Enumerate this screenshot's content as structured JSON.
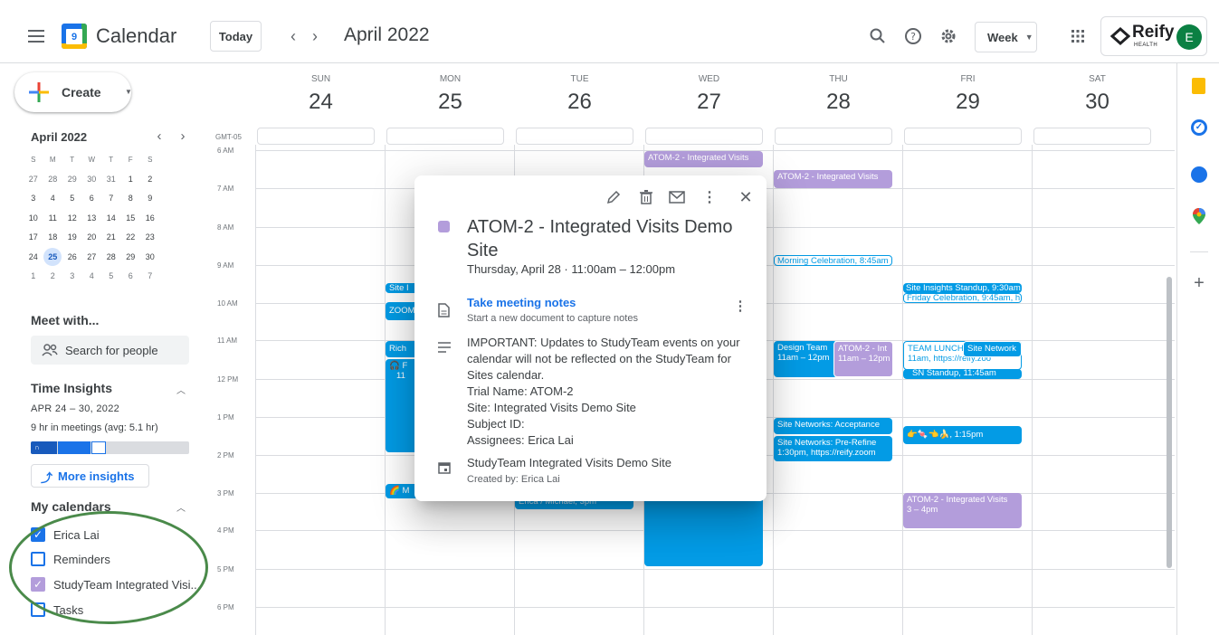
{
  "header": {
    "app_title": "Calendar",
    "logo_day": "9",
    "today_label": "Today",
    "period_label": "April 2022",
    "view_label": "Week",
    "brand_text": "Reify",
    "brand_sub": "HEALTH",
    "avatar_letter": "E"
  },
  "sidebar": {
    "create_label": "Create",
    "mini_cal": {
      "title": "April 2022",
      "weekdays": [
        "S",
        "M",
        "T",
        "W",
        "T",
        "F",
        "S"
      ],
      "weeks": [
        [
          "27",
          "28",
          "29",
          "30",
          "31",
          "1",
          "2"
        ],
        [
          "3",
          "4",
          "5",
          "6",
          "7",
          "8",
          "9"
        ],
        [
          "10",
          "11",
          "12",
          "13",
          "14",
          "15",
          "16"
        ],
        [
          "17",
          "18",
          "19",
          "20",
          "21",
          "22",
          "23"
        ],
        [
          "24",
          "25",
          "26",
          "27",
          "28",
          "29",
          "30"
        ],
        [
          "1",
          "2",
          "3",
          "4",
          "5",
          "6",
          "7"
        ]
      ],
      "selected": "25"
    },
    "meet_with": "Meet with...",
    "search_placeholder": "Search for people",
    "time_insights": {
      "title": "Time Insights",
      "range": "APR 24 – 30, 2022",
      "summary": "9 hr in meetings (avg: 5.1 hr)",
      "more": "More insights"
    },
    "my_calendars": {
      "title": "My calendars",
      "items": [
        {
          "label": "Erica Lai",
          "checked": true,
          "color": "#1a73e8"
        },
        {
          "label": "Reminders",
          "checked": false,
          "color": "#1a73e8"
        },
        {
          "label": "StudyTeam Integrated Visi...",
          "checked": true,
          "color": "#b39ddb"
        },
        {
          "label": "Tasks",
          "checked": false,
          "color": "#1a73e8"
        }
      ]
    }
  },
  "grid": {
    "timezone": "GMT-05",
    "days": [
      {
        "name": "SUN",
        "num": "24"
      },
      {
        "name": "MON",
        "num": "25"
      },
      {
        "name": "TUE",
        "num": "26"
      },
      {
        "name": "WED",
        "num": "27"
      },
      {
        "name": "THU",
        "num": "28"
      },
      {
        "name": "FRI",
        "num": "29"
      },
      {
        "name": "SAT",
        "num": "30"
      }
    ],
    "hours": [
      "6 AM",
      "7 AM",
      "8 AM",
      "9 AM",
      "10 AM",
      "11 AM",
      "12 PM",
      "1 PM",
      "2 PM",
      "3 PM",
      "4 PM",
      "5 PM",
      "6 PM"
    ]
  },
  "events": {
    "wed_atom": "ATOM-2 - Integrated Visits",
    "thu_atom": "ATOM-2 - Integrated Visits",
    "thu_morning": "Morning Celebration, 8:45am",
    "thu_design_1": "Design Team",
    "thu_design_2": "11am – 12pm",
    "thu_atom2_1": "ATOM-2 - Int",
    "thu_atom2_2": "11am – 12pm",
    "thu_acceptance": "Site Networks: Acceptance",
    "thu_prerefine_1": "Site Networks: Pre-Refine",
    "thu_prerefine_2": "1:30pm, https://reify.zoom",
    "fri_standup": "Site Insights Standup, 9:30am",
    "fri_celebration": "Friday Celebration, 9:45am, h",
    "fri_lunch_1": "TEAM LUNCH",
    "fri_lunch_2": "11am, https://reify.zoo",
    "fri_sitenet": "Site Network",
    "fri_sn": "SN Standup, 11:45am",
    "fri_emoji": "👉🍬👈🍌, 1:15pm",
    "fri_atom_1": "ATOM-2 - Integrated Visits",
    "fri_atom_2": "3 – 4pm",
    "mon_site": "Site I",
    "mon_zoom": "ZOOM",
    "mon_rich": "Rich",
    "mon_focus_1": "🎧 F",
    "mon_focus_2": "11",
    "mon_m": "🌈 M",
    "tue_erica": "Erica / Michael, 3pm"
  },
  "popup": {
    "title": "ATOM-2 - Integrated Visits Demo Site",
    "when": "Thursday, April 28  ·  11:00am – 12:00pm",
    "notes_link": "Take meeting notes",
    "notes_sub": "Start a new document to capture notes",
    "description": [
      "IMPORTANT: Updates to StudyTeam events on your calendar will not be reflected on the StudyTeam for Sites calendar.",
      "Trial Name: ATOM-2",
      "Site: Integrated Visits Demo Site",
      "Subject ID:",
      "Assignees: Erica Lai"
    ],
    "calendar_name": "StudyTeam Integrated Visits Demo Site",
    "created_by": "Created by: Erica Lai",
    "event_color": "#b39ddb"
  },
  "colors": {
    "accent": "#1a73e8",
    "event_blue": "#039be5",
    "event_purple": "#b39ddb",
    "highlight_circle": "#4a8a4a"
  }
}
